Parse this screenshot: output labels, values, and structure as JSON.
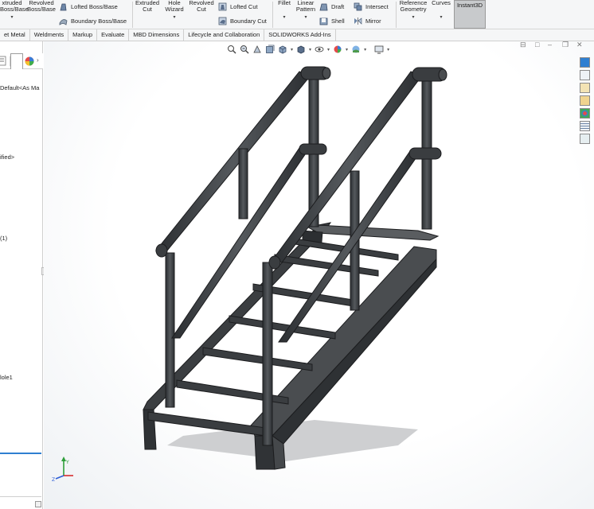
{
  "ribbon": {
    "features": [
      {
        "label": "xtruded\nBoss/Base"
      },
      {
        "label": "Revolved\nBoss/Base"
      },
      {
        "label": "Extruded\nCut"
      },
      {
        "label": "Hole\nWizard"
      },
      {
        "label": "Revolved\nCut"
      },
      {
        "label": "Fillet"
      },
      {
        "label": "Linear\nPattern"
      },
      {
        "label": "Reference\nGeometry"
      },
      {
        "label": "Curves"
      },
      {
        "label": "Instant3D"
      }
    ],
    "small": {
      "lofted_boss": "Lofted Boss/Base",
      "boundary_boss": "Boundary Boss/Base",
      "lofted_cut": "Lofted Cut",
      "boundary_cut": "Boundary Cut",
      "draft": "Draft",
      "shell": "Shell",
      "intersect": "Intersect",
      "mirror": "Mirror"
    }
  },
  "tabs": [
    "et Metal",
    "Weldments",
    "Markup",
    "Evaluate",
    "MBD Dimensions",
    "Lifecycle and Collaboration",
    "SOLIDWORKS Add-Ins"
  ],
  "tree": {
    "config": "Default<As Ma",
    "material": "ified>",
    "item1": "(1)",
    "hole": "lole1"
  },
  "colors": {
    "ribbon_bg": "#f5f6f7",
    "model_steel": "#3a3d40",
    "accent_blue": "#2f7fd1"
  },
  "icons": [
    "zoom-to-fit-icon",
    "zoom-area-icon",
    "previous-view-icon",
    "section-view-icon",
    "view-orientation-icon",
    "display-style-icon",
    "hide-show-icon",
    "edit-appearance-icon",
    "apply-scene-icon",
    "view-settings-icon"
  ]
}
